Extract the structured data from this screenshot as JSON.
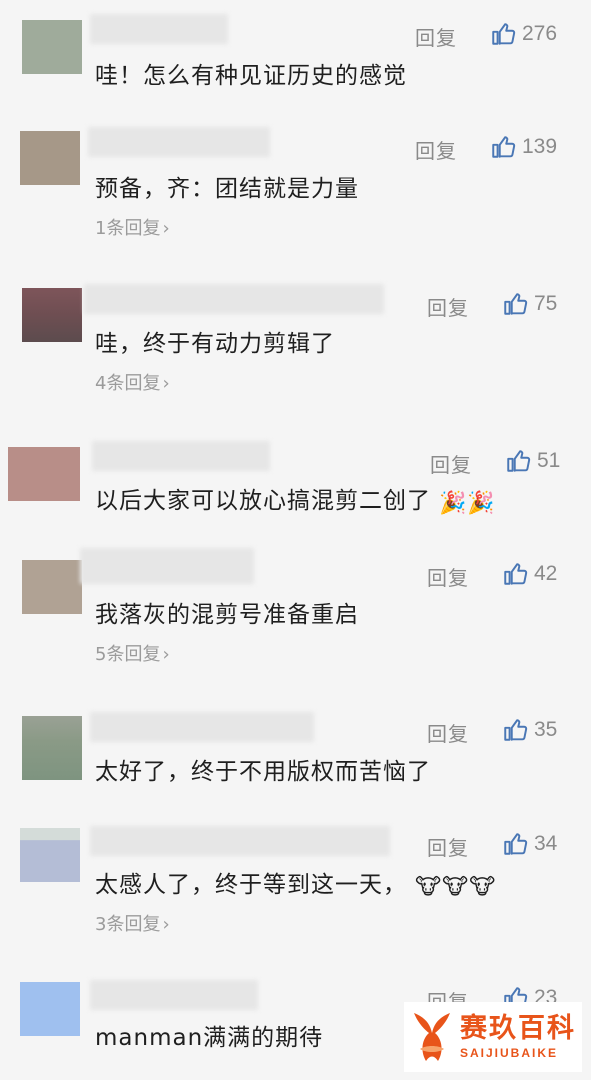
{
  "reply_label": "回复",
  "comments": [
    {
      "avatar_color": "#9fab9b",
      "likes": "276",
      "text": "哇！怎么有种见证历史的感觉",
      "sub_replies": ""
    },
    {
      "avatar_color": "#a69888",
      "likes": "139",
      "text": "预备，齐：团结就是力量",
      "sub_replies": "1条回复"
    },
    {
      "avatar_color": "#6e4e52",
      "likes": "75",
      "text": "哇，终于有动力剪辑了",
      "sub_replies": "4条回复"
    },
    {
      "avatar_color": "#b88e88",
      "likes": "51",
      "text": "以后大家可以放心搞混剪二创了",
      "emoji": "🎉🎉",
      "sub_replies": ""
    },
    {
      "avatar_color": "#b0a294",
      "likes": "42",
      "text": "我落灰的混剪号准备重启",
      "sub_replies": "5条回复"
    },
    {
      "avatar_color": "#8a9a86",
      "likes": "35",
      "text": "太好了，终于不用版权而苦恼了",
      "sub_replies": ""
    },
    {
      "avatar_color": "#b4bdd6",
      "likes": "34",
      "text": "太感人了，终于等到这一天，",
      "emoji": "🐮🐮🐮",
      "sub_replies": "3条回复"
    },
    {
      "avatar_color": "#9fc0ef",
      "likes": "23",
      "text": "manman满满的期待",
      "sub_replies": ""
    }
  ],
  "watermark": {
    "cn": "赛玖百科",
    "en": "SAIJIUBAIKE",
    "color": "#e8541a"
  }
}
